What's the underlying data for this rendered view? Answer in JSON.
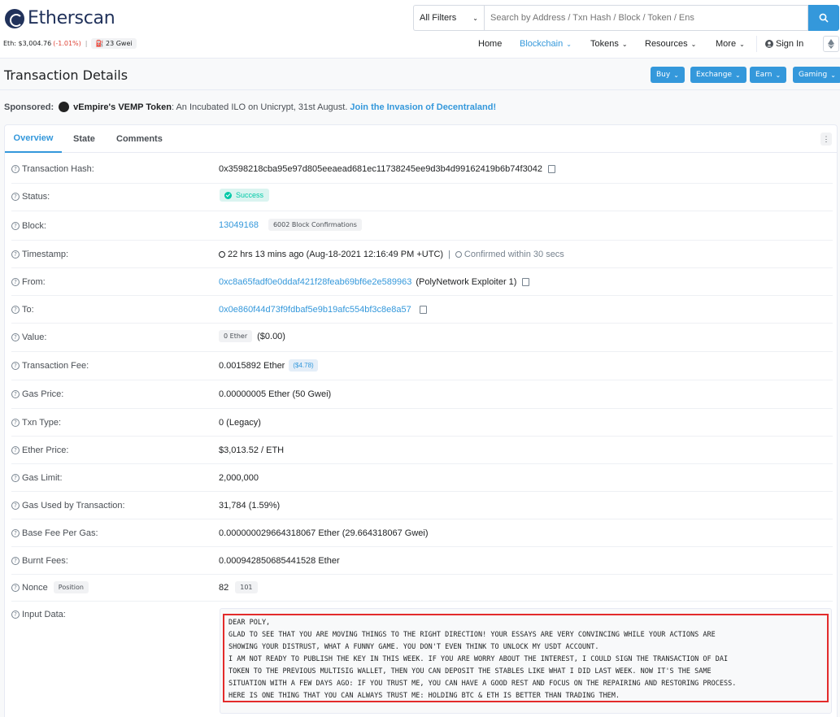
{
  "header": {
    "logo_text": "Etherscan",
    "eth_price_label": "Eth: $3,004.76",
    "eth_change": "(-1.01%)",
    "gas": "23 Gwei",
    "filter_label": "All Filters",
    "search_placeholder": "Search by Address / Txn Hash / Block / Token / Ens",
    "nav": {
      "home": "Home",
      "blockchain": "Blockchain",
      "tokens": "Tokens",
      "resources": "Resources",
      "more": "More",
      "sign_in": "Sign In"
    }
  },
  "page": {
    "title": "Transaction Details",
    "buttons": {
      "buy": "Buy",
      "exchange": "Exchange",
      "earn": "Earn",
      "gaming": "Gaming"
    }
  },
  "sponsored": {
    "label": "Sponsored:",
    "token": "vEmpire's VEMP Token",
    "text": ": An Incubated ILO on Unicrypt, 31st August.",
    "link": "Join the Invasion of Decentraland!"
  },
  "tabs": {
    "overview": "Overview",
    "state": "State",
    "comments": "Comments"
  },
  "details": {
    "tx_hash_label": "Transaction Hash:",
    "tx_hash": "0x3598218cba95e97d805eeaead681ec11738245ee9d3b4d99162419b6b74f3042",
    "status_label": "Status:",
    "status": "Success",
    "block_label": "Block:",
    "block": "13049168",
    "confirmations": "6002 Block Confirmations",
    "timestamp_label": "Timestamp:",
    "timestamp": "22 hrs 13 mins ago (Aug-18-2021 12:16:49 PM +UTC)",
    "timestamp_sep": "|",
    "confirmed": "Confirmed within 30 secs",
    "from_label": "From:",
    "from": "0xc8a65fadf0e0ddaf421f28feab69bf6e2e589963",
    "from_tag": "(PolyNetwork Exploiter 1)",
    "to_label": "To:",
    "to": "0x0e860f44d73f9fdbaf5e9b19afc554bf3c8e8a57",
    "value_label": "Value:",
    "value": "0 Ether",
    "value_usd": "($0.00)",
    "fee_label": "Transaction Fee:",
    "fee": "0.0015892 Ether",
    "fee_usd": "($4.78)",
    "gas_price_label": "Gas Price:",
    "gas_price": "0.00000005 Ether (50 Gwei)",
    "txn_type_label": "Txn Type:",
    "txn_type": "0 (Legacy)",
    "ether_price_label": "Ether Price:",
    "ether_price": "$3,013.52 / ETH",
    "gas_limit_label": "Gas Limit:",
    "gas_limit": "2,000,000",
    "gas_used_label": "Gas Used by Transaction:",
    "gas_used": "31,784 (1.59%)",
    "base_fee_label": "Base Fee Per Gas:",
    "base_fee": "0.000000029664318067 Ether (29.664318067 Gwei)",
    "burnt_label": "Burnt Fees:",
    "burnt": "0.000942850685441528 Ether",
    "nonce_label": "Nonce",
    "position_label": "Position",
    "nonce": "82",
    "position": "101",
    "input_label": "Input Data:",
    "input_text": "DEAR POLY,\nGLAD TO SEE THAT YOU ARE MOVING THINGS TO THE RIGHT DIRECTION! YOUR ESSAYS ARE VERY CONVINCING WHILE YOUR ACTIONS ARE\nSHOWING YOUR DISTRUST, WHAT A FUNNY GAME. YOU DON'T EVEN THINK TO UNLOCK MY USDT ACCOUNT.\nI AM NOT READY TO PUBLISH THE KEY IN THIS WEEK. IF YOU ARE WORRY ABOUT THE INTEREST, I COULD SIGN THE TRANSACTION OF DAI\nTOKEN TO THE PREVIOUS MULTISIG WALLET, THEN YOU CAN DEPOSIT THE STABLES LIKE WHAT I DID LAST WEEK. NOW IT'S THE SAME\nSITUATION WITH A FEW DAYS AGO: IF YOU TRUST ME, YOU CAN HAVE A GOOD REST AND FOCUS ON THE REPAIRING AND RESTORING PROCESS.\nHERE IS ONE THING THAT YOU CAN ALWAYS TRUST ME: HOLDING BTC & ETH IS BETTER THAN TRADING THEM."
  },
  "colors": {
    "accent": "#3498db",
    "success": "#00c9a7",
    "highlight": "#e32b2b",
    "negative": "#de4437"
  }
}
